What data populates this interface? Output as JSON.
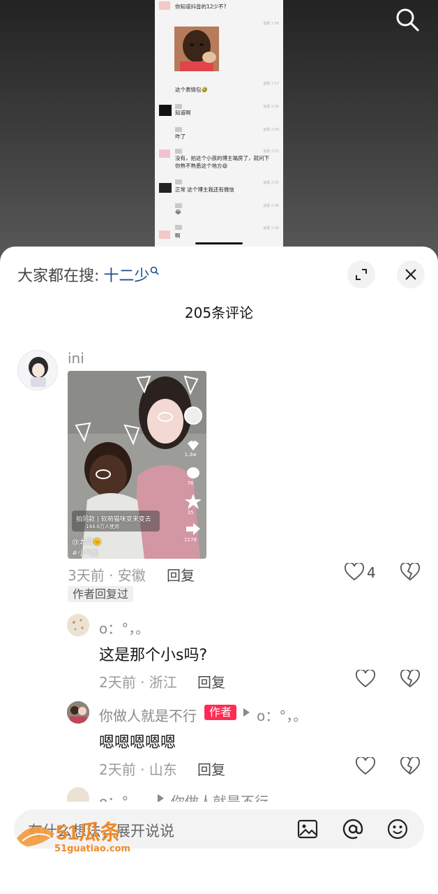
{
  "video": {
    "chat": {
      "messages": [
        {
          "text": "你知道抖音的12少不?",
          "time": ""
        },
        {
          "text": "",
          "time": "凌晨 1:56"
        },
        {
          "text": "这个表情包🤣",
          "time": "凌晨 1:57"
        },
        {
          "text": "知道啊",
          "time": "凌晨 2:00"
        },
        {
          "text": "咋了",
          "time": "凌晨 2:00"
        },
        {
          "text": "没有，拍这个小孩的博主塌房了，就问下",
          "text2": "你熟不熟悉这个地方😄",
          "time": "凌晨 2:01"
        },
        {
          "text": "正常 这个博主我还有微信",
          "time": "凌晨 2:05"
        },
        {
          "text": "😂",
          "time": "凌晨 2:06"
        },
        {
          "text": "啊",
          "time": "凌晨 2:06"
        }
      ]
    },
    "search_icon": "search-icon"
  },
  "sheet": {
    "hot_search_label": "大家都在搜:",
    "hot_search_term": "十二少",
    "expand_icon": "expand-icon",
    "close_icon": "close-icon",
    "comment_count": "205条评论"
  },
  "comments": [
    {
      "username": "ini",
      "image": {
        "badge": "拍同款 | 软萌猫咪变来变去",
        "usage": "144.6万人使用",
        "author": "@太阳🌞",
        "tag": "#小气鬼",
        "counts": [
          "1.3w",
          "76",
          "35",
          "1178"
        ]
      },
      "time_location": "3天前 · 安徽",
      "reply_label": "回复",
      "likes": "4",
      "author_replied": "作者回复过",
      "replies": [
        {
          "username": "o：°，。",
          "text": "这是那个小s吗?",
          "time_location": "2天前 · 浙江",
          "reply_label": "回复"
        },
        {
          "username": "你做人就是不行",
          "badge": "作者",
          "reply_to": "o：°，。",
          "text": "嗯嗯嗯嗯嗯",
          "time_location": "2天前 · 山东",
          "reply_label": "回复"
        },
        {
          "username": "o：°，。",
          "reply_to": "你做人就是不行"
        }
      ]
    }
  ],
  "input": {
    "placeholder": "有什么想法，展开说说",
    "icons": [
      "image-icon",
      "at-icon",
      "emoji-icon"
    ]
  },
  "watermark": {
    "text": "51瓜条",
    "url": "51guatiao.com"
  },
  "colors": {
    "accent": "#fe2c55",
    "hot_term": "#1d4e8f"
  }
}
